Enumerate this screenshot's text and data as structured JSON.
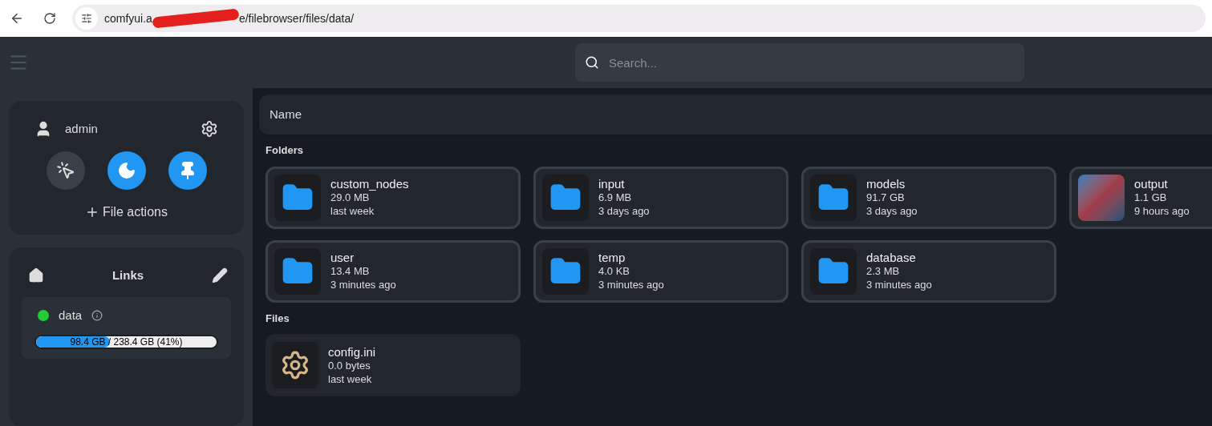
{
  "browser": {
    "address_start": "comfyui.a",
    "address_end": "e/filebrowser/files/data/"
  },
  "header": {
    "search": {
      "placeholder": "Search..."
    }
  },
  "sidebar": {
    "user": {
      "name": "admin"
    },
    "toggles": [
      {
        "kind": "select",
        "on": false
      },
      {
        "kind": "dark",
        "on": true
      },
      {
        "kind": "pin",
        "on": true
      }
    ],
    "file_actions": "File actions",
    "links": {
      "title": "Links",
      "sources": [
        {
          "name": "data",
          "color": "#22cc33",
          "level": 0.41,
          "usage": "98.4 GB / 238.4 GB (41%)"
        }
      ]
    }
  },
  "listing": {
    "column_header": "Name",
    "sections": [
      {
        "title": "Folders",
        "items": [
          {
            "kind": "folder",
            "name": "custom_nodes",
            "size": "29.0 MB",
            "modified": "last week"
          },
          {
            "kind": "folder",
            "name": "input",
            "size": "6.9 MB",
            "modified": "3 days ago"
          },
          {
            "kind": "folder",
            "name": "models",
            "size": "91.7 GB",
            "modified": "3 days ago"
          },
          {
            "kind": "image",
            "name": "output",
            "size": "1.1 GB",
            "modified": "9 hours ago"
          },
          {
            "kind": "folder",
            "name": "user",
            "size": "13.4 MB",
            "modified": "3 minutes ago"
          },
          {
            "kind": "folder",
            "name": "temp",
            "size": "4.0 KB",
            "modified": "3 minutes ago"
          },
          {
            "kind": "folder",
            "name": "database",
            "size": "2.3 MB",
            "modified": "3 minutes ago"
          }
        ]
      },
      {
        "title": "Files",
        "items": [
          {
            "kind": "config",
            "name": "config.ini",
            "size": "0.0 bytes",
            "modified": "last week"
          }
        ]
      }
    ]
  }
}
